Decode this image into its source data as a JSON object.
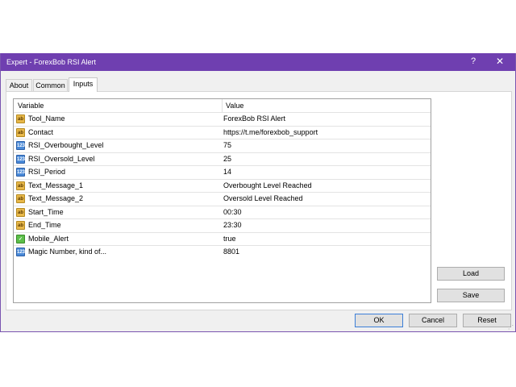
{
  "window": {
    "title": "Expert - ForexBob RSI Alert",
    "help_label": "?",
    "close_label": "✕"
  },
  "tabs": [
    {
      "label": "About"
    },
    {
      "label": "Common"
    },
    {
      "label": "Inputs"
    }
  ],
  "active_tab": "Inputs",
  "table": {
    "headers": {
      "variable": "Variable",
      "value": "Value"
    },
    "rows": [
      {
        "type": "ab",
        "icon": "string-icon",
        "name": "Tool_Name",
        "value": "ForexBob RSI Alert"
      },
      {
        "type": "ab",
        "icon": "string-icon",
        "name": "Contact",
        "value": "https://t.me/forexbob_support"
      },
      {
        "type": "123",
        "icon": "integer-icon",
        "name": "RSI_Overbought_Level",
        "value": "75"
      },
      {
        "type": "123",
        "icon": "integer-icon",
        "name": "RSI_Oversold_Level",
        "value": "25"
      },
      {
        "type": "123",
        "icon": "integer-icon",
        "name": "RSI_Period",
        "value": "14"
      },
      {
        "type": "ab",
        "icon": "string-icon",
        "name": "Text_Message_1",
        "value": "Overbought Level Reached"
      },
      {
        "type": "ab",
        "icon": "string-icon",
        "name": "Text_Message_2",
        "value": "Oversold Level Reached"
      },
      {
        "type": "ab",
        "icon": "string-icon",
        "name": "Start_Time",
        "value": "00:30"
      },
      {
        "type": "ab",
        "icon": "string-icon",
        "name": "End_Time",
        "value": "23:30"
      },
      {
        "type": "✓",
        "icon": "bool-icon",
        "name": "Mobile_Alert",
        "value": "true"
      },
      {
        "type": "123",
        "icon": "integer-icon",
        "name": "Magic Number, kind of...",
        "value": "8801"
      }
    ]
  },
  "side_buttons": {
    "load": "Load",
    "save": "Save"
  },
  "footer_buttons": {
    "ok": "OK",
    "cancel": "Cancel",
    "reset": "Reset"
  },
  "colors": {
    "titlebar": "#6f3fb0",
    "default_button_border": "#3c7fd8"
  }
}
